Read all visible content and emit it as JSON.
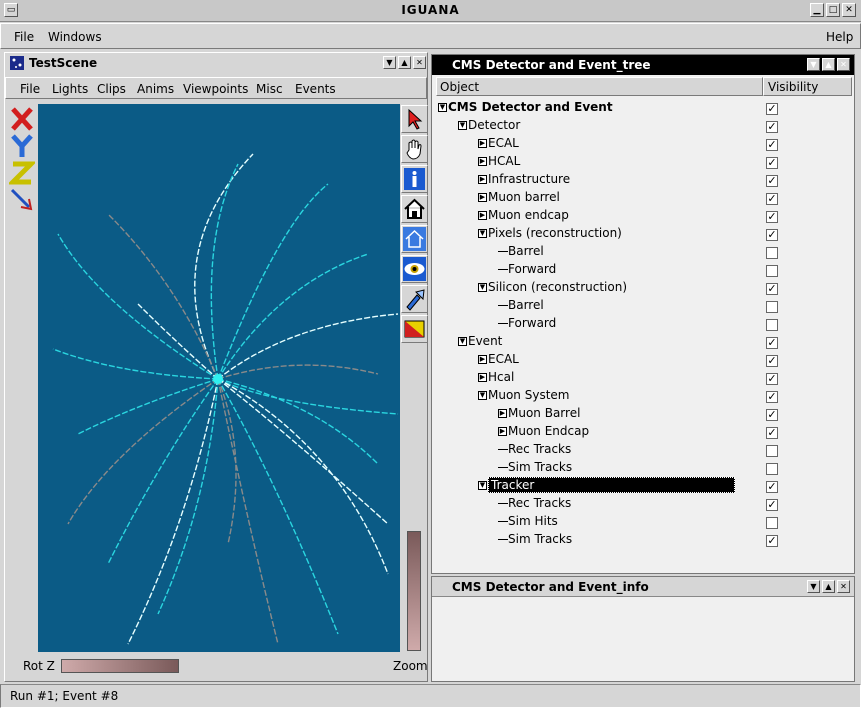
{
  "window": {
    "title": "IGUANA"
  },
  "menubar": {
    "file": "File",
    "windows": "Windows",
    "help": "Help"
  },
  "scene": {
    "title": "TestScene",
    "menu": [
      "File",
      "Lights",
      "Clips",
      "Anims",
      "Viewpoints",
      "Misc",
      "Events"
    ],
    "left_tools": [
      "x-axis-icon",
      "y-axis-icon",
      "z-axis-icon",
      "pick-arrow-icon"
    ],
    "right_tools": [
      "select-arrow-icon",
      "hand-icon",
      "info-icon",
      "home-icon",
      "set-home-icon",
      "eye-icon",
      "flashlight-icon",
      "toggle-icon"
    ],
    "rot_label": "Rot Z",
    "zoom_label": "Zoom",
    "bg_color": "#0b5b86"
  },
  "tree": {
    "title": "CMS Detector and Event_tree",
    "col_object": "Object",
    "col_visibility": "Visibility",
    "rows": [
      {
        "label": "CMS Detector and Event",
        "depth": 0,
        "expander": "open",
        "checked": true,
        "bold": true
      },
      {
        "label": "Detector",
        "depth": 1,
        "expander": "open",
        "checked": true
      },
      {
        "label": "ECAL",
        "depth": 2,
        "expander": "closed",
        "checked": true
      },
      {
        "label": "HCAL",
        "depth": 2,
        "expander": "closed",
        "checked": true
      },
      {
        "label": "Infrastructure",
        "depth": 2,
        "expander": "closed",
        "checked": true
      },
      {
        "label": "Muon barrel",
        "depth": 2,
        "expander": "closed",
        "checked": true
      },
      {
        "label": "Muon endcap",
        "depth": 2,
        "expander": "closed",
        "checked": true
      },
      {
        "label": "Pixels (reconstruction)",
        "depth": 2,
        "expander": "open",
        "checked": true
      },
      {
        "label": "Barrel",
        "depth": 3,
        "expander": "none",
        "checked": false
      },
      {
        "label": "Forward",
        "depth": 3,
        "expander": "none",
        "checked": false
      },
      {
        "label": "Silicon (reconstruction)",
        "depth": 2,
        "expander": "open",
        "checked": true
      },
      {
        "label": "Barrel",
        "depth": 3,
        "expander": "none",
        "checked": false
      },
      {
        "label": "Forward",
        "depth": 3,
        "expander": "none",
        "checked": false
      },
      {
        "label": "Event",
        "depth": 1,
        "expander": "open",
        "checked": true
      },
      {
        "label": "ECAL",
        "depth": 2,
        "expander": "closed",
        "checked": true
      },
      {
        "label": "Hcal",
        "depth": 2,
        "expander": "closed",
        "checked": true
      },
      {
        "label": "Muon System",
        "depth": 2,
        "expander": "open",
        "checked": true
      },
      {
        "label": "Muon Barrel",
        "depth": 3,
        "expander": "closed",
        "checked": true
      },
      {
        "label": "Muon Endcap",
        "depth": 3,
        "expander": "closed",
        "checked": true
      },
      {
        "label": "Rec Tracks",
        "depth": 3,
        "expander": "none",
        "checked": false
      },
      {
        "label": "Sim Tracks",
        "depth": 3,
        "expander": "none",
        "checked": false
      },
      {
        "label": "Tracker",
        "depth": 2,
        "expander": "open",
        "checked": true,
        "selected": true
      },
      {
        "label": "Rec Tracks",
        "depth": 3,
        "expander": "none",
        "checked": true
      },
      {
        "label": "Sim Hits",
        "depth": 3,
        "expander": "none",
        "checked": false
      },
      {
        "label": "Sim Tracks",
        "depth": 3,
        "expander": "none",
        "checked": true
      }
    ]
  },
  "info": {
    "title": "CMS Detector and Event_info"
  },
  "status": {
    "text": "Run #1; Event #8"
  }
}
